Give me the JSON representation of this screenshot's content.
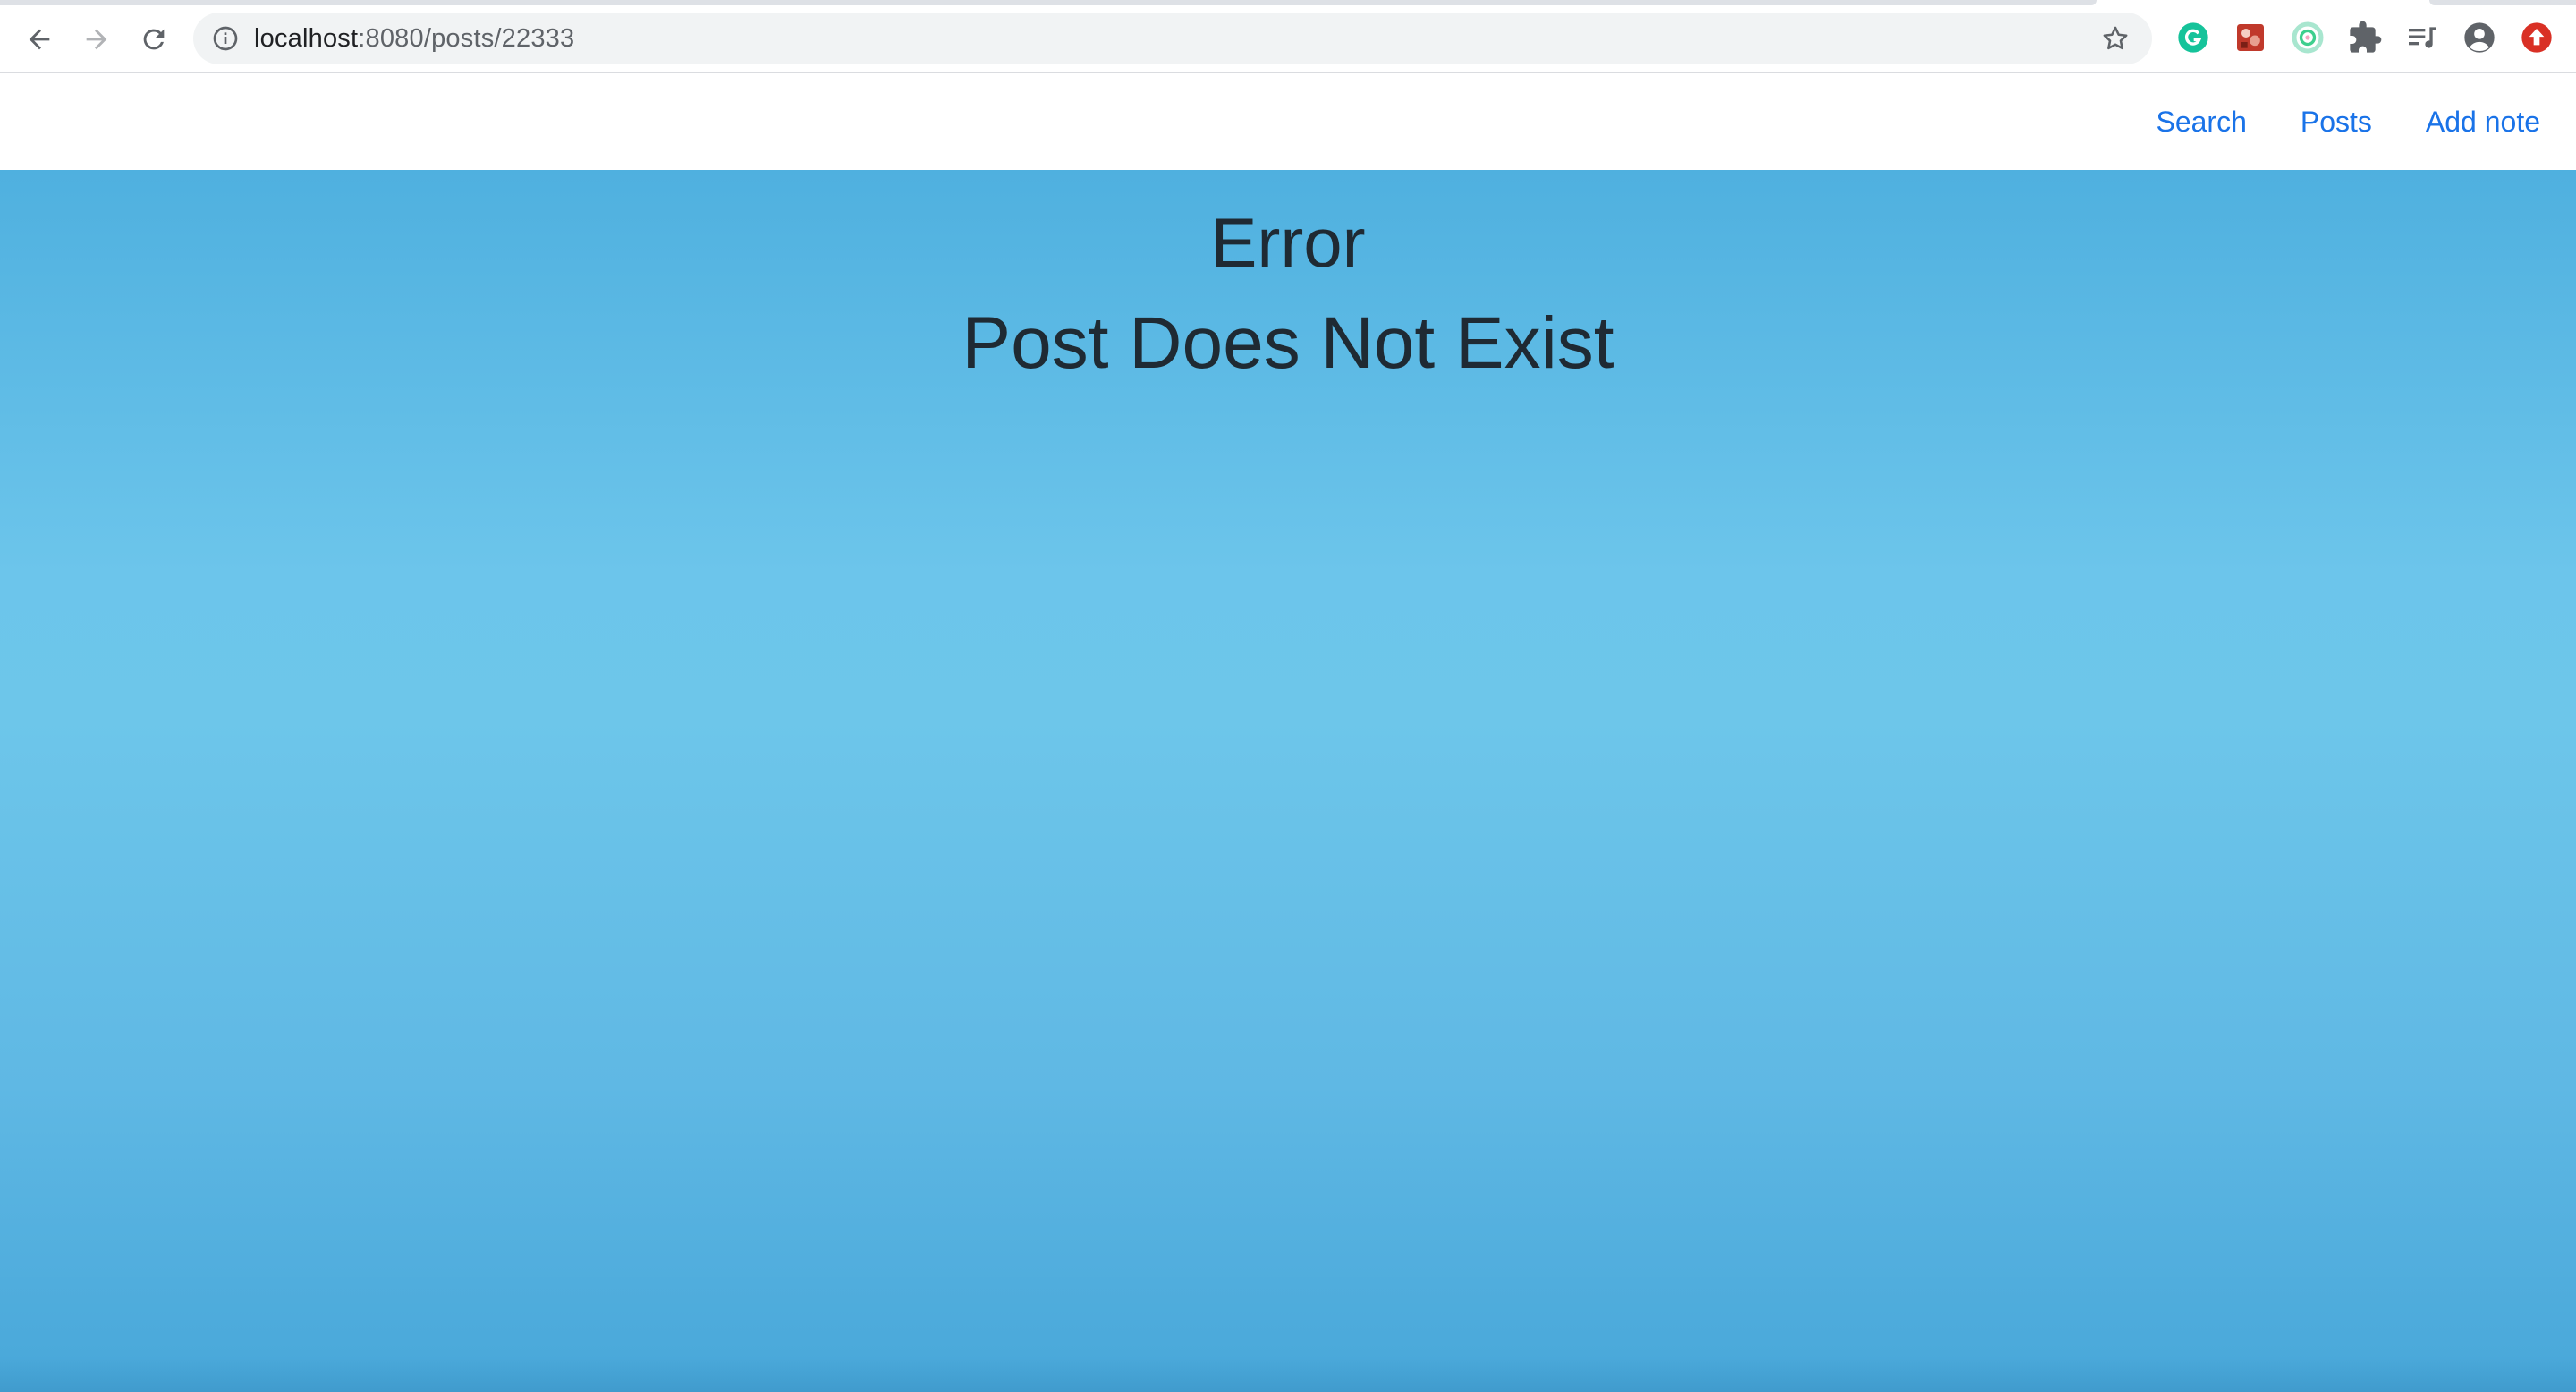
{
  "browser": {
    "url_host": "localhost",
    "url_path": ":8080/posts/22333",
    "icons": {
      "back": "back-arrow-icon",
      "forward": "forward-arrow-icon",
      "reload": "reload-icon",
      "site_info": "info-icon",
      "bookmark": "star-icon",
      "extensions": [
        "grammarly-icon",
        "red-extension-icon",
        "green-ring-extension-icon",
        "puzzle-icon",
        "media-queue-icon",
        "profile-icon",
        "update-icon"
      ]
    }
  },
  "navbar": {
    "links": [
      {
        "label": "Search"
      },
      {
        "label": "Posts"
      },
      {
        "label": "Add note"
      }
    ],
    "link_color": "#1a73e8"
  },
  "main": {
    "title": "Error",
    "message": "Post Does Not Exist",
    "background_colors": [
      "#4fb0df",
      "#6dc6ea",
      "#48a7d9"
    ],
    "text_color": "#1f2a33"
  }
}
